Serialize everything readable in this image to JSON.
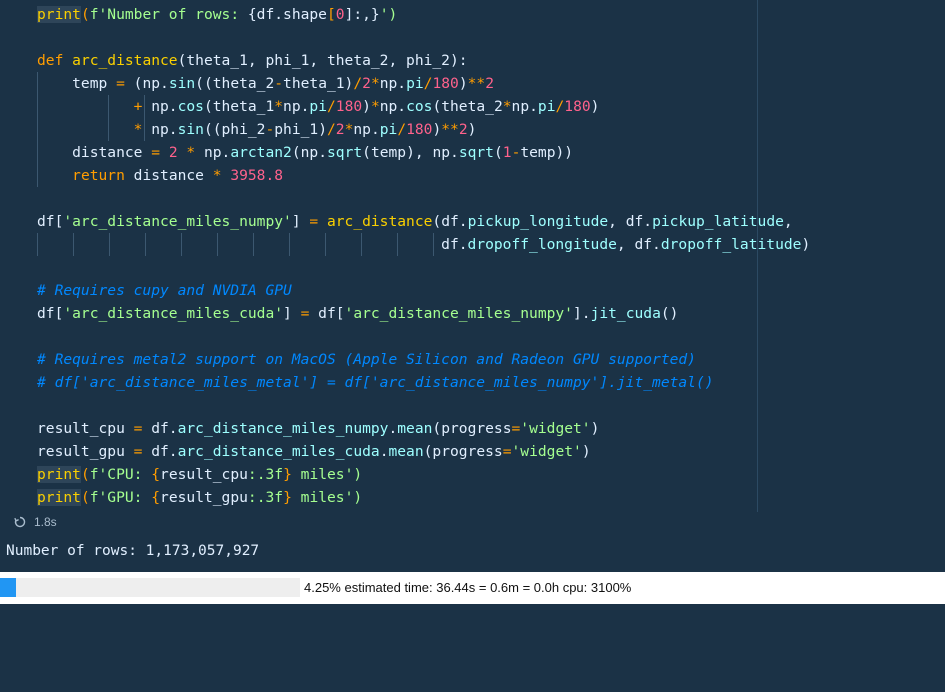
{
  "code_lines": [
    [
      {
        "t": "print",
        "c": "kw-fn hl"
      },
      {
        "t": "(",
        "c": "op"
      },
      {
        "t": "f'Number of rows: ",
        "c": "str"
      },
      {
        "t": "{df.shape",
        "c": ""
      },
      {
        "t": "[",
        "c": "op"
      },
      {
        "t": "0",
        "c": "num"
      },
      {
        "t": "]:,}",
        "c": ""
      },
      {
        "t": "')",
        "c": "str"
      }
    ],
    [],
    [
      {
        "t": "def ",
        "c": "kw-def"
      },
      {
        "t": "arc_distance",
        "c": "kw-fn"
      },
      {
        "t": "(theta_1, phi_1, theta_2, phi_2):",
        "c": ""
      }
    ],
    [
      {
        "t": "    temp ",
        "c": ""
      },
      {
        "t": "= ",
        "c": "op"
      },
      {
        "t": "(np.",
        "c": ""
      },
      {
        "t": "sin",
        "c": "attr"
      },
      {
        "t": "((theta_2",
        "c": ""
      },
      {
        "t": "-",
        "c": "op"
      },
      {
        "t": "theta_1)",
        "c": ""
      },
      {
        "t": "/",
        "c": "op"
      },
      {
        "t": "2",
        "c": "num"
      },
      {
        "t": "*",
        "c": "op"
      },
      {
        "t": "np.",
        "c": ""
      },
      {
        "t": "pi",
        "c": "attr"
      },
      {
        "t": "/",
        "c": "op"
      },
      {
        "t": "180",
        "c": "num"
      },
      {
        "t": ")",
        "c": ""
      },
      {
        "t": "**",
        "c": "op"
      },
      {
        "t": "2",
        "c": "num"
      }
    ],
    [
      {
        "t": "           ",
        "c": ""
      },
      {
        "t": "+ ",
        "c": "op"
      },
      {
        "t": "np.",
        "c": ""
      },
      {
        "t": "cos",
        "c": "attr"
      },
      {
        "t": "(theta_1",
        "c": ""
      },
      {
        "t": "*",
        "c": "op"
      },
      {
        "t": "np.",
        "c": ""
      },
      {
        "t": "pi",
        "c": "attr"
      },
      {
        "t": "/",
        "c": "op"
      },
      {
        "t": "180",
        "c": "num"
      },
      {
        "t": ")",
        "c": ""
      },
      {
        "t": "*",
        "c": "op"
      },
      {
        "t": "np.",
        "c": ""
      },
      {
        "t": "cos",
        "c": "attr"
      },
      {
        "t": "(theta_2",
        "c": ""
      },
      {
        "t": "*",
        "c": "op"
      },
      {
        "t": "np.",
        "c": ""
      },
      {
        "t": "pi",
        "c": "attr"
      },
      {
        "t": "/",
        "c": "op"
      },
      {
        "t": "180",
        "c": "num"
      },
      {
        "t": ")",
        "c": ""
      }
    ],
    [
      {
        "t": "           ",
        "c": ""
      },
      {
        "t": "* ",
        "c": "op"
      },
      {
        "t": "np.",
        "c": ""
      },
      {
        "t": "sin",
        "c": "attr"
      },
      {
        "t": "((phi_2",
        "c": ""
      },
      {
        "t": "-",
        "c": "op"
      },
      {
        "t": "phi_1)",
        "c": ""
      },
      {
        "t": "/",
        "c": "op"
      },
      {
        "t": "2",
        "c": "num"
      },
      {
        "t": "*",
        "c": "op"
      },
      {
        "t": "np.",
        "c": ""
      },
      {
        "t": "pi",
        "c": "attr"
      },
      {
        "t": "/",
        "c": "op"
      },
      {
        "t": "180",
        "c": "num"
      },
      {
        "t": ")",
        "c": ""
      },
      {
        "t": "**",
        "c": "op"
      },
      {
        "t": "2",
        "c": "num"
      },
      {
        "t": ")",
        "c": ""
      }
    ],
    [
      {
        "t": "    distance ",
        "c": ""
      },
      {
        "t": "= ",
        "c": "op"
      },
      {
        "t": "2 ",
        "c": "num"
      },
      {
        "t": "* ",
        "c": "op"
      },
      {
        "t": "np.",
        "c": ""
      },
      {
        "t": "arctan2",
        "c": "attr"
      },
      {
        "t": "(np.",
        "c": ""
      },
      {
        "t": "sqrt",
        "c": "attr"
      },
      {
        "t": "(temp), np.",
        "c": ""
      },
      {
        "t": "sqrt",
        "c": "attr"
      },
      {
        "t": "(",
        "c": ""
      },
      {
        "t": "1",
        "c": "num"
      },
      {
        "t": "-",
        "c": "op"
      },
      {
        "t": "temp))",
        "c": ""
      }
    ],
    [
      {
        "t": "    ",
        "c": ""
      },
      {
        "t": "return ",
        "c": "kw-def"
      },
      {
        "t": "distance ",
        "c": ""
      },
      {
        "t": "* ",
        "c": "op"
      },
      {
        "t": "3958.8",
        "c": "num"
      }
    ],
    [],
    [
      {
        "t": "df[",
        "c": ""
      },
      {
        "t": "'arc_distance_miles_numpy'",
        "c": "str"
      },
      {
        "t": "] ",
        "c": ""
      },
      {
        "t": "= ",
        "c": "op"
      },
      {
        "t": "arc_distance",
        "c": "kw-fn"
      },
      {
        "t": "(df.",
        "c": ""
      },
      {
        "t": "pickup_longitude",
        "c": "attr"
      },
      {
        "t": ", df.",
        "c": ""
      },
      {
        "t": "pickup_latitude",
        "c": "attr"
      },
      {
        "t": ",",
        "c": ""
      }
    ],
    [
      {
        "t": "                                              df.",
        "c": ""
      },
      {
        "t": "dropoff_longitude",
        "c": "attr"
      },
      {
        "t": ", df.",
        "c": ""
      },
      {
        "t": "dropoff_latitude",
        "c": "attr"
      },
      {
        "t": ")",
        "c": ""
      }
    ],
    [],
    [
      {
        "t": "# Requires cupy and NVDIA GPU",
        "c": "cm"
      }
    ],
    [
      {
        "t": "df[",
        "c": ""
      },
      {
        "t": "'arc_distance_miles_cuda'",
        "c": "str"
      },
      {
        "t": "] ",
        "c": ""
      },
      {
        "t": "= ",
        "c": "op"
      },
      {
        "t": "df[",
        "c": ""
      },
      {
        "t": "'arc_distance_miles_numpy'",
        "c": "str"
      },
      {
        "t": "].",
        "c": ""
      },
      {
        "t": "jit_cuda",
        "c": "attr"
      },
      {
        "t": "()",
        "c": ""
      }
    ],
    [],
    [
      {
        "t": "# Requires metal2 support on MacOS (Apple Silicon and Radeon GPU supported)",
        "c": "cm"
      }
    ],
    [
      {
        "t": "# df['arc_distance_miles_metal'] = df['arc_distance_miles_numpy'].jit_metal()",
        "c": "cm"
      }
    ],
    [],
    [
      {
        "t": "result_cpu ",
        "c": ""
      },
      {
        "t": "= ",
        "c": "op"
      },
      {
        "t": "df.",
        "c": ""
      },
      {
        "t": "arc_distance_miles_numpy",
        "c": "attr"
      },
      {
        "t": ".",
        "c": ""
      },
      {
        "t": "mean",
        "c": "attr"
      },
      {
        "t": "(progress",
        "c": ""
      },
      {
        "t": "=",
        "c": "op"
      },
      {
        "t": "'widget'",
        "c": "str"
      },
      {
        "t": ")",
        "c": ""
      }
    ],
    [
      {
        "t": "result_gpu ",
        "c": ""
      },
      {
        "t": "= ",
        "c": "op"
      },
      {
        "t": "df.",
        "c": ""
      },
      {
        "t": "arc_distance_miles_cuda",
        "c": "attr"
      },
      {
        "t": ".",
        "c": ""
      },
      {
        "t": "mean",
        "c": "attr"
      },
      {
        "t": "(progress",
        "c": ""
      },
      {
        "t": "=",
        "c": "op"
      },
      {
        "t": "'widget'",
        "c": "str"
      },
      {
        "t": ")",
        "c": ""
      }
    ],
    [
      {
        "t": "print",
        "c": "kw-fn hl"
      },
      {
        "t": "(",
        "c": "op"
      },
      {
        "t": "f'CPU: ",
        "c": "str"
      },
      {
        "t": "{",
        "c": "op"
      },
      {
        "t": "result_cpu",
        "c": ""
      },
      {
        "t": ":.3f",
        "c": "str"
      },
      {
        "t": "}",
        "c": "op"
      },
      {
        "t": " miles')",
        "c": "str"
      }
    ],
    [
      {
        "t": "print",
        "c": "kw-fn hl"
      },
      {
        "t": "(",
        "c": "op"
      },
      {
        "t": "f'GPU: ",
        "c": "str"
      },
      {
        "t": "{",
        "c": "op"
      },
      {
        "t": "result_gpu",
        "c": ""
      },
      {
        "t": ":.3f",
        "c": "str"
      },
      {
        "t": "}",
        "c": "op"
      },
      {
        "t": " miles')",
        "c": "str"
      }
    ]
  ],
  "exec": {
    "icon": "refresh-icon",
    "time": "1.8s"
  },
  "output": {
    "text": "Number of rows: 1,173,057,927",
    "progress": {
      "fraction": 0.0425,
      "label": "4.25% estimated time: 36.44s = 0.6m = 0.0h cpu: 3100%",
      "color": "#2196f3"
    }
  }
}
